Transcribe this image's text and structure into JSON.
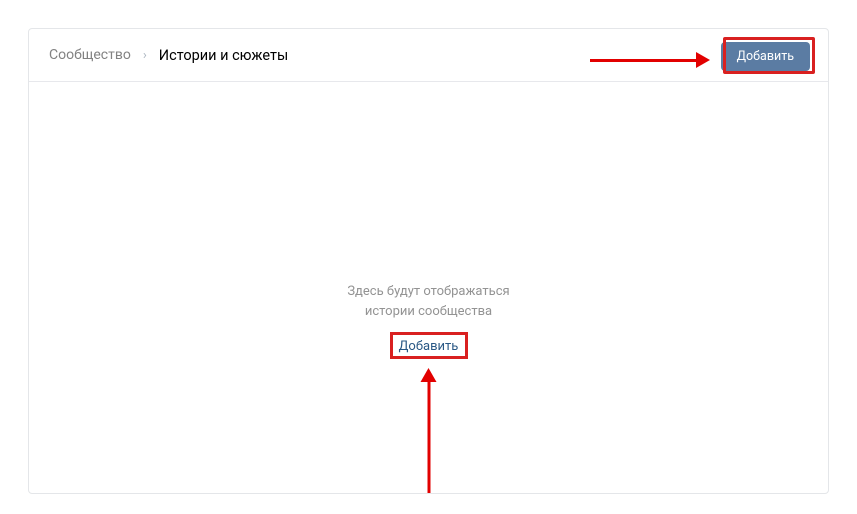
{
  "breadcrumb": {
    "parent": "Сообщество",
    "current": "Истории и сюжеты"
  },
  "header": {
    "add_button_label": "Добавить"
  },
  "empty_state": {
    "line1": "Здесь будут отображаться",
    "line2": "истории сообщества",
    "add_link_label": "Добавить"
  }
}
